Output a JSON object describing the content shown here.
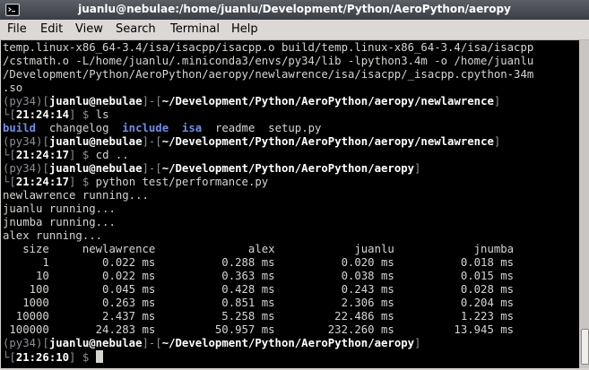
{
  "window": {
    "title": "juanlu@nebulae:/home/juanlu/Development/Python/AeroPython/aeropy"
  },
  "menu": {
    "items": [
      "File",
      "Edit",
      "View",
      "Search",
      "Terminal",
      "Help"
    ]
  },
  "terminal": {
    "lines": [
      [
        {
          "t": "temp.linux-x86_64-3.4/isa/isacpp/isacpp.o build/temp.linux-x86_64-3.4/isa/isacpp"
        }
      ],
      [
        {
          "t": "/cstmath.o -L/home/juanlu/.miniconda3/envs/py34/lib -lpython3.4m -o /home/juanlu"
        }
      ],
      [
        {
          "t": "/Development/Python/AeroPython/aeropy/newlawrence/isa/isacpp/_isacpp.cpython-34m"
        }
      ],
      [
        {
          "t": ".so"
        }
      ],
      [
        {
          "t": "(py34)",
          "c": "dim"
        },
        {
          "t": "[",
          "c": "dim"
        },
        {
          "t": "juanlu@nebulae",
          "c": "user bold"
        },
        {
          "t": "]-[",
          "c": "dim"
        },
        {
          "t": "~/Development/Python/AeroPython/aeropy/newlawrence",
          "c": "path bold"
        },
        {
          "t": "]",
          "c": "dim"
        }
      ],
      [
        {
          "t": "└[",
          "c": "dim"
        },
        {
          "t": "21:24:14",
          "c": "user bold"
        },
        {
          "t": "] $ ",
          "c": "dim"
        },
        {
          "t": "ls"
        }
      ],
      [
        {
          "t": "build",
          "c": "blue"
        },
        {
          "t": "  changelog  "
        },
        {
          "t": "include",
          "c": "blue"
        },
        {
          "t": "  "
        },
        {
          "t": "isa",
          "c": "blue"
        },
        {
          "t": "  readme  setup.py"
        }
      ],
      [
        {
          "t": "(py34)",
          "c": "dim"
        },
        {
          "t": "[",
          "c": "dim"
        },
        {
          "t": "juanlu@nebulae",
          "c": "user bold"
        },
        {
          "t": "]-[",
          "c": "dim"
        },
        {
          "t": "~/Development/Python/AeroPython/aeropy/newlawrence",
          "c": "path bold"
        },
        {
          "t": "]",
          "c": "dim"
        }
      ],
      [
        {
          "t": "└[",
          "c": "dim"
        },
        {
          "t": "21:24:17",
          "c": "user bold"
        },
        {
          "t": "] $ ",
          "c": "dim"
        },
        {
          "t": "cd .."
        }
      ],
      [
        {
          "t": "(py34)",
          "c": "dim"
        },
        {
          "t": "[",
          "c": "dim"
        },
        {
          "t": "juanlu@nebulae",
          "c": "user bold"
        },
        {
          "t": "]-[",
          "c": "dim"
        },
        {
          "t": "~/Development/Python/AeroPython/aeropy",
          "c": "path bold"
        },
        {
          "t": "]",
          "c": "dim"
        }
      ],
      [
        {
          "t": "└[",
          "c": "dim"
        },
        {
          "t": "21:24:17",
          "c": "user bold"
        },
        {
          "t": "] $ ",
          "c": "dim"
        },
        {
          "t": "python test/performance.py"
        }
      ],
      [
        {
          "t": "newlawrence running..."
        }
      ],
      [
        {
          "t": "juanlu running..."
        }
      ],
      [
        {
          "t": "jnumba running..."
        }
      ],
      [
        {
          "t": "alex running..."
        }
      ],
      [
        {
          "t": "   size     newlawrence              alex            juanlu            jnumba"
        }
      ],
      [
        {
          "t": "      1        0.022 ms          0.288 ms          0.020 ms          0.018 ms"
        }
      ],
      [
        {
          "t": "     10        0.022 ms          0.363 ms          0.038 ms          0.015 ms"
        }
      ],
      [
        {
          "t": "    100        0.045 ms          0.428 ms          0.243 ms          0.028 ms"
        }
      ],
      [
        {
          "t": "   1000        0.263 ms          0.851 ms          2.306 ms          0.204 ms"
        }
      ],
      [
        {
          "t": "  10000        2.437 ms          5.258 ms         22.486 ms          1.223 ms"
        }
      ],
      [
        {
          "t": " 100000       24.283 ms         50.957 ms        232.260 ms         13.945 ms"
        }
      ],
      [
        {
          "t": "(py34)",
          "c": "dim"
        },
        {
          "t": "[",
          "c": "dim"
        },
        {
          "t": "juanlu@nebulae",
          "c": "user bold"
        },
        {
          "t": "]-[",
          "c": "dim"
        },
        {
          "t": "~/Development/Python/AeroPython/aeropy",
          "c": "path bold"
        },
        {
          "t": "]",
          "c": "dim"
        }
      ],
      [
        {
          "t": "└[",
          "c": "dim"
        },
        {
          "t": "21:26:10",
          "c": "user bold"
        },
        {
          "t": "] $ ",
          "c": "dim"
        },
        {
          "t": "",
          "cursor": true
        }
      ]
    ]
  }
}
